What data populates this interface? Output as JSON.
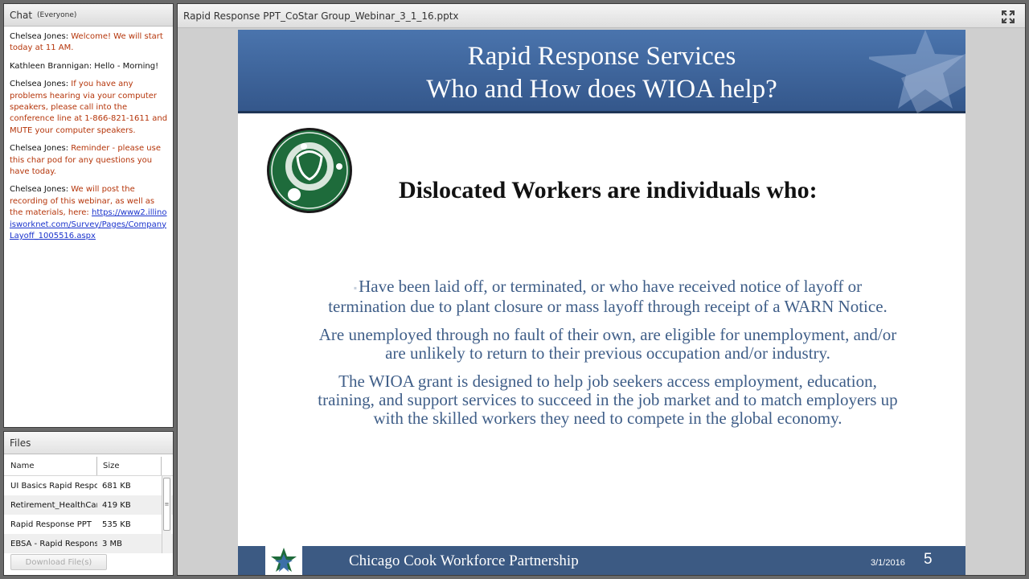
{
  "chat": {
    "title": "Chat",
    "audience": "(Everyone)",
    "messages": [
      {
        "sender": "Chelsea Jones:",
        "text": "Welcome! We will start today at 11 AM.",
        "style": "red"
      },
      {
        "sender": "Kathleen Brannigan:",
        "text": "Hello - Morning!",
        "style": "dark"
      },
      {
        "sender": "Chelsea Jones:",
        "text": "If you have any problems hearing via your computer speakers, please call into the conference line at 1-866-821-1611 and MUTE your computer speakers.",
        "style": "red"
      },
      {
        "sender": "Chelsea Jones:",
        "text": "Reminder - please use this char pod for any questions you have today.",
        "style": "red"
      },
      {
        "sender": "Chelsea Jones:",
        "text": "We will post the recording of this webinar, as well as the materials, here:",
        "style": "red",
        "link": " https://www2.illinoisworknet.com/Survey/Pages/CompanyLayoff_1005516.aspx"
      }
    ]
  },
  "files": {
    "title": "Files",
    "columns": {
      "name": "Name",
      "size": "Size"
    },
    "rows": [
      {
        "name": "UI Basics Rapid Response",
        "size": "681 KB"
      },
      {
        "name": "Retirement_HealthCare",
        "size": "419 KB"
      },
      {
        "name": "Rapid Response PPT",
        "size": "535 KB"
      },
      {
        "name": "EBSA - Rapid Response",
        "size": "3 MB"
      }
    ],
    "download_label": "Download File(s)"
  },
  "share": {
    "title": "Rapid Response PPT_CoStar Group_Webinar_3_1_16.pptx"
  },
  "slide": {
    "title_line1": "Rapid Response Services",
    "title_line2": "Who and How does WIOA help?",
    "subheading": "Dislocated Workers are individuals who:",
    "bullet1_line1": "Have been laid off, or terminated, or who have received notice of layoff or",
    "bullet1_line2": "termination due to plant closure or mass layoff through receipt of a   WARN Notice.",
    "bullet2_line1": "Are unemployed through no fault of their own, are eligible for unemployment, and/or",
    "bullet2_line2": "are unlikely to return to their previous occupation and/or industry.",
    "bullet3_line1": "The WIOA grant is designed to help job seekers access employment, education,",
    "bullet3_line2": "training, and support services to succeed in the job market and to match employers up",
    "bullet3_line3": "with the skilled workers they need to compete in the global economy.",
    "footer_org": "Chicago Cook Workforce Partnership",
    "footer_date": "3/1/2016",
    "page_number": "5"
  },
  "colors": {
    "slide_header": "#3f65a0",
    "slide_text": "#3f5e88",
    "chat_red": "#b5350a",
    "link": "#1a33cc",
    "logo_green": "#1e6b3b"
  },
  "icons": [
    "fullscreen-icon",
    "green-logo-icon",
    "star-icon",
    "scroll-grip-icon"
  ]
}
